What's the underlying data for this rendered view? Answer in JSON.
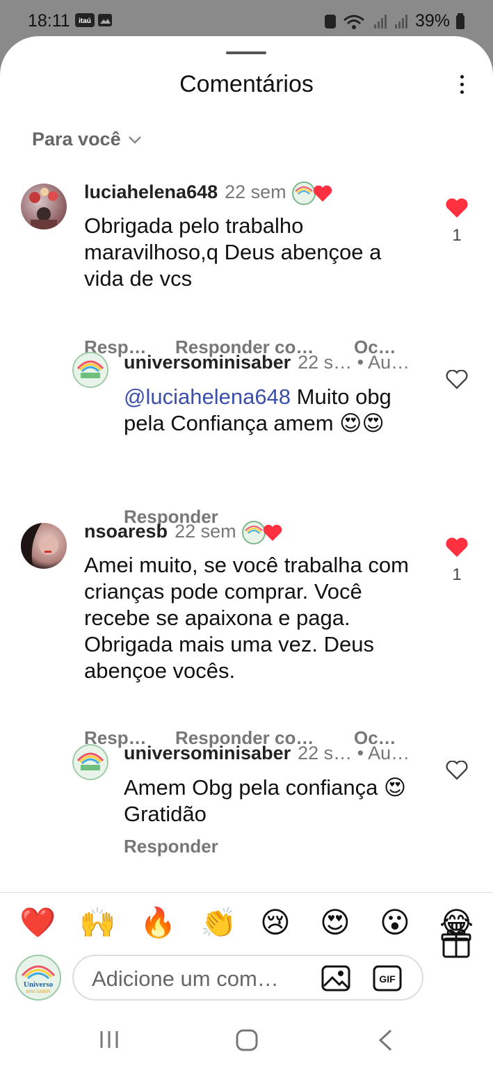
{
  "status": {
    "time": "18:11",
    "carrier_badge": "itaú",
    "battery": "39%"
  },
  "sheet": {
    "title": "Comentários",
    "sort_label": "Para você"
  },
  "comments": [
    {
      "username": "luciahelena648",
      "time": "22 sem",
      "text": "Obrigada pelo trabalho maravilhoso,q Deus abençoe a vida de vcs",
      "actions": [
        "Resp…",
        "Responder co…",
        "Oc…"
      ],
      "likes": "1",
      "liked": true
    },
    {
      "username": "universominisaber",
      "meta": "22 s… • Au…",
      "mention": "@luciahelena648",
      "text": " Muito obg pela Confiança amem 😍😍",
      "actions": [
        "Responder"
      ],
      "liked": false
    },
    {
      "username": "nsoaresb",
      "time": "22 sem",
      "text": "Amei muito, se você trabalha com crianças pode comprar. Você recebe se apaixona e paga. Obrigada mais uma vez. Deus abençoe vocês.",
      "actions": [
        "Resp…",
        "Responder co…",
        "Oc…"
      ],
      "likes": "1",
      "liked": true
    },
    {
      "username": "universominisaber",
      "meta": "22 s… • Au…",
      "text": "Amem Obg  pela confiança 😍Gratidão",
      "actions": [
        "Responder"
      ],
      "liked": false
    }
  ],
  "emoji_bar": [
    "❤️",
    "🙌",
    "🔥",
    "👏",
    "😢",
    "😍",
    "😮",
    "😂"
  ],
  "composer": {
    "placeholder": "Adicione um com…",
    "gif_label": "GIF",
    "avatar_text": "Universo",
    "avatar_subtext": "MINI SABER"
  },
  "colors": {
    "like_red": "#ff3040",
    "mention_blue": "#3b4ea8",
    "status_bar_gray": "#8a8a8a"
  }
}
